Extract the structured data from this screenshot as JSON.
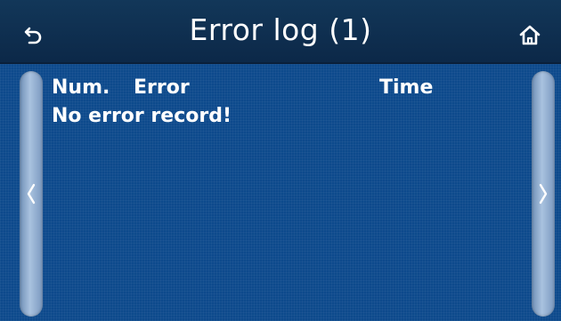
{
  "header": {
    "title": "Error log (1)",
    "back_icon": "back-arrow-icon",
    "home_icon": "home-icon"
  },
  "table": {
    "columns": [
      "Num.",
      "Error",
      "Time"
    ],
    "empty_message": "No error record!"
  },
  "nav": {
    "prev_icon": "chevron-left-icon",
    "next_icon": "chevron-right-icon"
  },
  "colors": {
    "header_bg": "#123759",
    "content_bg": "#0d4a8c",
    "side_panel": "#a9c2df",
    "text": "#ffffff"
  }
}
